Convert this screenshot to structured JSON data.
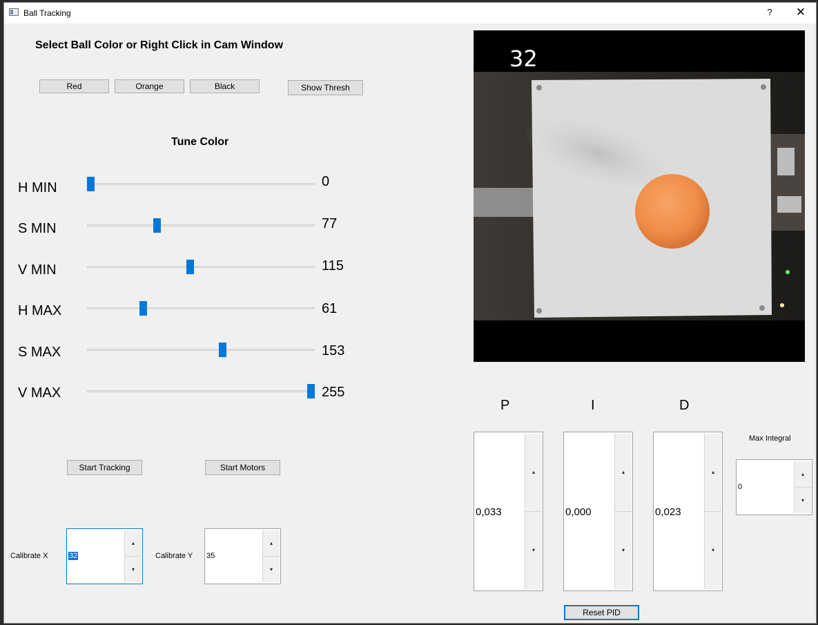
{
  "window": {
    "title": "Ball Tracking",
    "help_label": "?",
    "close_label": "✕"
  },
  "select": {
    "heading": "Select Ball Color or Right Click in Cam Window",
    "red_label": "Red",
    "orange_label": "Orange",
    "black_label": "Black",
    "show_thresh_label": "Show Thresh"
  },
  "tune": {
    "heading": "Tune Color",
    "sliders": [
      {
        "label": "H MIN",
        "value": "0",
        "min": 0,
        "max": 255
      },
      {
        "label": "S MIN",
        "value": "77",
        "min": 0,
        "max": 255
      },
      {
        "label": "V MIN",
        "value": "115",
        "min": 0,
        "max": 255
      },
      {
        "label": "H MAX",
        "value": "61",
        "min": 0,
        "max": 255
      },
      {
        "label": "S MAX",
        "value": "153",
        "min": 0,
        "max": 255
      },
      {
        "label": "V MAX",
        "value": "255",
        "min": 0,
        "max": 255
      }
    ]
  },
  "actions": {
    "start_tracking_label": "Start Tracking",
    "start_motors_label": "Start Motors"
  },
  "calibrate": {
    "x_label": "Calibrate X",
    "x_value": "32",
    "y_label": "Calibrate Y",
    "y_value": "35"
  },
  "camera": {
    "overlay_text": "32"
  },
  "pid": {
    "p_label": "P",
    "p_value": "0,033",
    "i_label": "I",
    "i_value": "0,000",
    "d_label": "D",
    "d_value": "0,023",
    "max_integral_label": "Max Integral",
    "max_integral_value": "0",
    "reset_label": "Reset PID"
  },
  "icons": {
    "up_arrow": "▴",
    "down_arrow": "▾"
  },
  "colors": {
    "accent": "#0078d7",
    "ball": "#f1914e",
    "platform": "#dcdcdc"
  }
}
